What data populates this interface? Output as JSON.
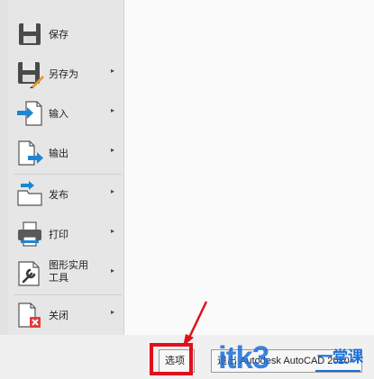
{
  "menu": {
    "items": [
      {
        "label": "保存",
        "icon": "save-icon",
        "arrow": ""
      },
      {
        "label": "另存为",
        "icon": "save-as-icon",
        "arrow": "▸"
      },
      {
        "label": "输入",
        "icon": "import-icon",
        "arrow": "▸"
      },
      {
        "label": "输出",
        "icon": "export-icon",
        "arrow": "▸"
      },
      {
        "label": "发布",
        "icon": "publish-icon",
        "arrow": "▸"
      },
      {
        "label": "打印",
        "icon": "print-icon",
        "arrow": "▸"
      },
      {
        "label": "图形实用\n工具",
        "icon": "drawing-utilities-icon",
        "arrow": "▸"
      },
      {
        "label": "关闭",
        "icon": "close-file-icon",
        "arrow": "▸"
      }
    ]
  },
  "bottom": {
    "options_label": "选项",
    "exit_label": "退出 Autodesk AutoCAD 2020"
  },
  "watermark": {
    "brand": "itk3",
    "cn": "一堂课"
  },
  "colors": {
    "highlight": "#e0101a",
    "accent_blue": "#1a6fd8"
  }
}
